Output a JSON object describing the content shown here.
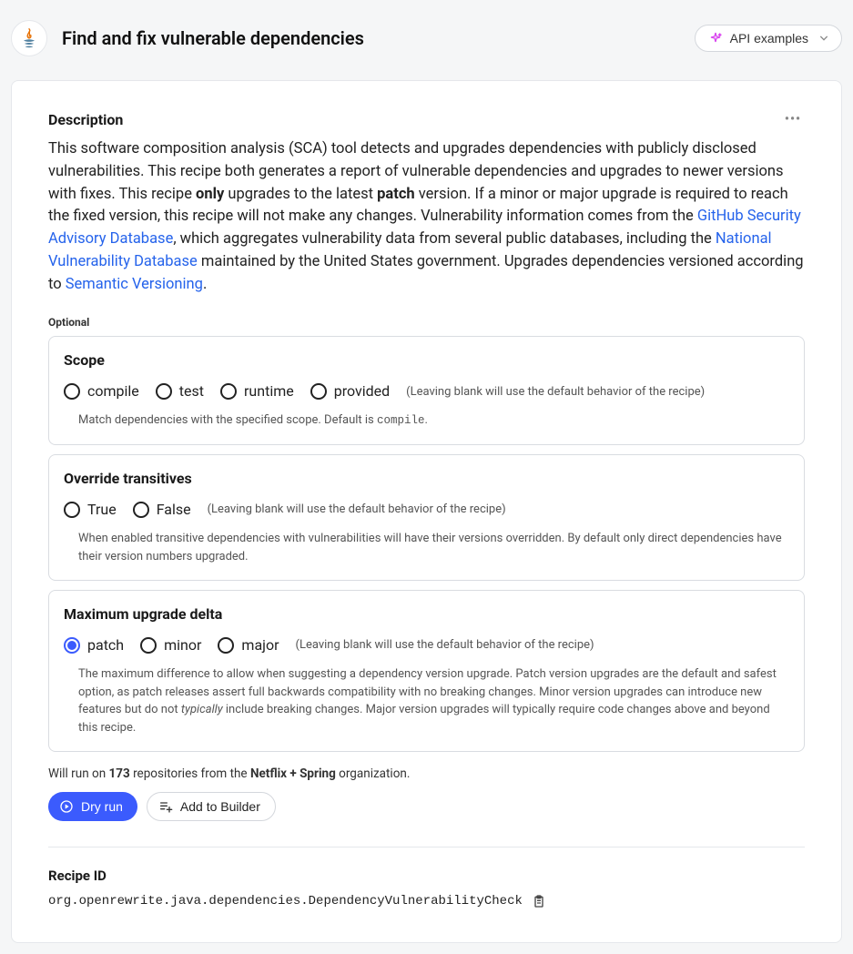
{
  "header": {
    "title": "Find and fix vulnerable dependencies",
    "api_btn_label": "API examples"
  },
  "description": {
    "heading": "Description",
    "p1a": "This software composition analysis (SCA) tool detects and upgrades dependencies with publicly disclosed vulnerabilities. This recipe both generates a report of vulnerable dependencies and upgrades to newer versions with fixes. This recipe ",
    "only": "only",
    "p1b": " upgrades to the latest ",
    "patch": "patch",
    "p1c": " version. If a minor or major upgrade is required to reach the fixed version, this recipe will not make any changes. Vulnerability information comes from the ",
    "link1": "GitHub Security Advisory Database",
    "p1d": ", which aggregates vulnerability data from several public databases, including the ",
    "link2": "National Vulnerability Database",
    "p1e": " maintained by the United States government. Upgrades dependencies versioned according to ",
    "link3": "Semantic Versioning",
    "p1f": "."
  },
  "optional_label": "Optional",
  "scope": {
    "title": "Scope",
    "options": {
      "o0": "compile",
      "o1": "test",
      "o2": "runtime",
      "o3": "provided"
    },
    "blank_hint": "(Leaving blank will use the default behavior of the recipe)",
    "help_a": "Match dependencies with the specified scope. Default is ",
    "help_code": "compile",
    "help_b": "."
  },
  "override": {
    "title": "Override transitives",
    "options": {
      "o0": "True",
      "o1": "False"
    },
    "blank_hint": "(Leaving blank will use the default behavior of the recipe)",
    "help": "When enabled transitive dependencies with vulnerabilities will have their versions overridden. By default only direct dependencies have their version numbers upgraded."
  },
  "maxdelta": {
    "title": "Maximum upgrade delta",
    "options": {
      "o0": "patch",
      "o1": "minor",
      "o2": "major"
    },
    "blank_hint": "(Leaving blank will use the default behavior of the recipe)",
    "help_a": "The maximum difference to allow when suggesting a dependency version upgrade. Patch version upgrades are the default and safest option, as patch releases assert full backwards compatibility with no breaking changes. Minor version upgrades can introduce new features but do not ",
    "help_em": "typically",
    "help_b": " include breaking changes. Major version upgrades will typically require code changes above and beyond this recipe."
  },
  "run_info": {
    "a": "Will run on ",
    "count": "173",
    "b": " repositories from the ",
    "org": "Netflix + Spring",
    "c": " organization."
  },
  "actions": {
    "dry_run": "Dry run",
    "add_to_builder": "Add to Builder"
  },
  "recipe_id": {
    "label": "Recipe ID",
    "value": "org.openrewrite.java.dependencies.DependencyVulnerabilityCheck"
  }
}
